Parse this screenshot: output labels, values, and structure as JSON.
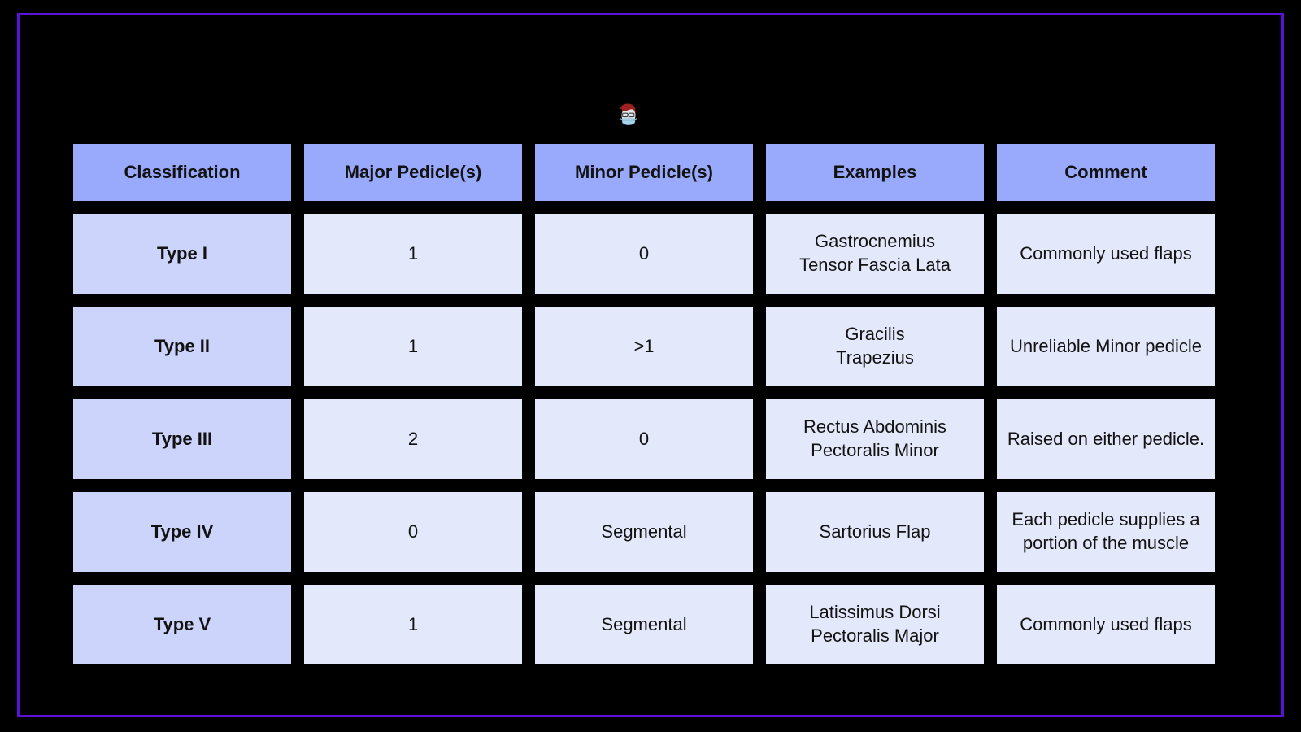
{
  "slide": {
    "background_color": "#000000",
    "border_color": "#5b12d8"
  },
  "avatar": {
    "icon": "person-with-mask-avatar-icon",
    "hair_color": "#9e2020",
    "mask_color": "#a7d3ea",
    "skin_color": "#e2e2e2",
    "glasses_color": "#3a3f4a"
  },
  "table": {
    "header_bg": "#99a9fb",
    "rowhead_bg": "#ccd4fb",
    "cell_bg": "#e4e8fb",
    "text_color": "#121212",
    "columns": [
      "Classification",
      "Major Pedicle(s)",
      "Minor Pedicle(s)",
      "Examples",
      "Comment"
    ],
    "rows": [
      {
        "classification": "Type I",
        "major": "1",
        "minor": "0",
        "examples": "Gastrocnemius\nTensor Fascia Lata",
        "comment": "Commonly used flaps"
      },
      {
        "classification": "Type II",
        "major": "1",
        "minor": ">1",
        "examples": "Gracilis\nTrapezius",
        "comment": "Unreliable Minor pedicle"
      },
      {
        "classification": "Type III",
        "major": "2",
        "minor": "0",
        "examples": "Rectus Abdominis\nPectoralis Minor",
        "comment": "Raised on either pedicle."
      },
      {
        "classification": "Type IV",
        "major": "0",
        "minor": "Segmental",
        "examples": "Sartorius Flap",
        "comment": "Each pedicle supplies a portion of the muscle"
      },
      {
        "classification": "Type V",
        "major": "1",
        "minor": "Segmental",
        "examples": "Latissimus Dorsi\nPectoralis Major",
        "comment": "Commonly used flaps"
      }
    ]
  }
}
